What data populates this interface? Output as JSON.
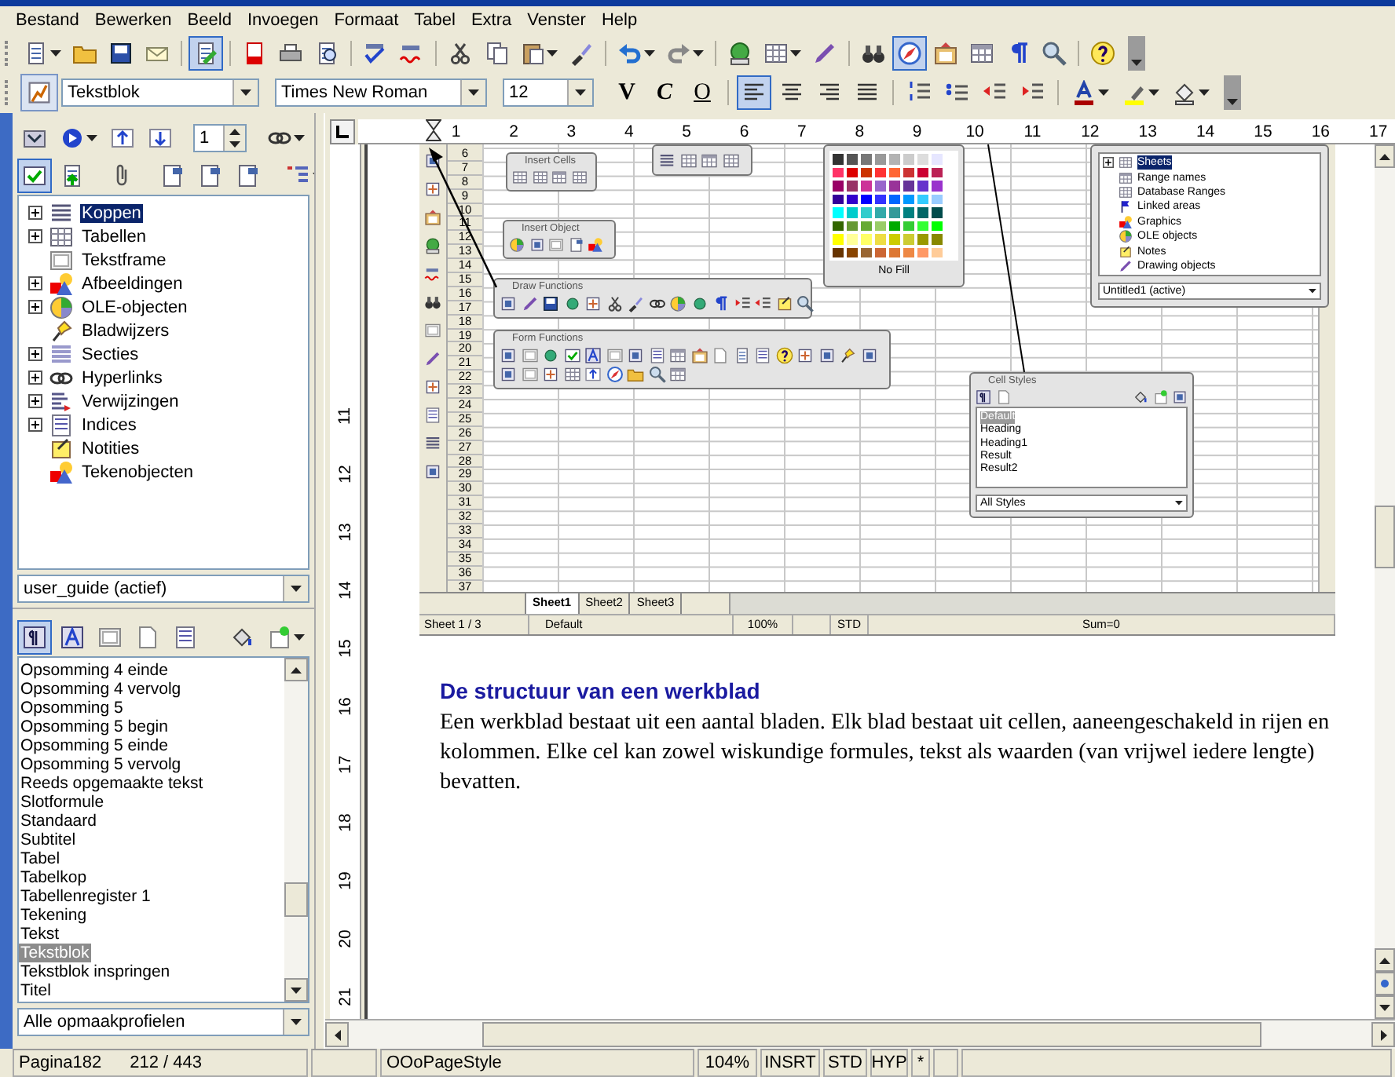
{
  "menu": [
    "Bestand",
    "Bewerken",
    "Beeld",
    "Invoegen",
    "Formaat",
    "Tabel",
    "Extra",
    "Venster",
    "Help"
  ],
  "standard_toolbar": {
    "edit_mode_on": true,
    "navigator_on": true
  },
  "format_toolbar": {
    "paragraph_style": "Tekstblok",
    "font_name": "Times New Roman",
    "font_size": "12",
    "style_buttons": [
      "V",
      "C",
      "O"
    ],
    "alignment": [
      {
        "selected": true
      },
      {
        "selected": false
      },
      {
        "selected": false
      },
      {
        "selected": false
      }
    ]
  },
  "navigator": {
    "page_number": "1",
    "content_view_on": true,
    "items": [
      {
        "label": "Koppen",
        "expandable": true,
        "selected": true
      },
      {
        "label": "Tabellen",
        "expandable": true,
        "selected": false
      },
      {
        "label": "Tekstframe",
        "expandable": false,
        "selected": false
      },
      {
        "label": "Afbeeldingen",
        "expandable": true,
        "selected": false
      },
      {
        "label": "OLE-objecten",
        "expandable": true,
        "selected": false
      },
      {
        "label": "Bladwijzers",
        "expandable": false,
        "selected": false
      },
      {
        "label": "Secties",
        "expandable": true,
        "selected": false
      },
      {
        "label": "Hyperlinks",
        "expandable": true,
        "selected": false
      },
      {
        "label": "Verwijzingen",
        "expandable": true,
        "selected": false
      },
      {
        "label": "Indices",
        "expandable": true,
        "selected": false
      },
      {
        "label": "Notities",
        "expandable": false,
        "selected": false
      },
      {
        "label": "Tekenobjecten",
        "expandable": false,
        "selected": false
      }
    ],
    "document": "user_guide (actief)"
  },
  "styles": {
    "categories": [
      {
        "selected": true
      },
      {
        "selected": false
      },
      {
        "selected": false
      },
      {
        "selected": false
      },
      {
        "selected": false
      }
    ],
    "items": [
      {
        "label": "Opsomming 4 einde",
        "selected": false
      },
      {
        "label": "Opsomming 4 vervolg",
        "selected": false
      },
      {
        "label": "Opsomming 5",
        "selected": false
      },
      {
        "label": "Opsomming 5 begin",
        "selected": false
      },
      {
        "label": "Opsomming 5 einde",
        "selected": false
      },
      {
        "label": "Opsomming 5 vervolg",
        "selected": false
      },
      {
        "label": "Reeds opgemaakte tekst",
        "selected": false
      },
      {
        "label": "Slotformule",
        "selected": false
      },
      {
        "label": "Standaard",
        "selected": false
      },
      {
        "label": "Subtitel",
        "selected": false
      },
      {
        "label": "Tabel",
        "selected": false
      },
      {
        "label": "Tabelkop",
        "selected": false
      },
      {
        "label": "Tabellenregister 1",
        "selected": false
      },
      {
        "label": "Tekening",
        "selected": false
      },
      {
        "label": "Tekst",
        "selected": false
      },
      {
        "label": "Tekstblok",
        "selected": true
      },
      {
        "label": "Tekstblok inspringen",
        "selected": false
      },
      {
        "label": "Titel",
        "selected": false
      }
    ],
    "filter": "Alle opmaakprofielen"
  },
  "ruler": {
    "horizontal": [
      "1",
      "2",
      "3",
      "4",
      "5",
      "6",
      "7",
      "8",
      "9",
      "10",
      "11",
      "12",
      "13",
      "14",
      "15",
      "16",
      "17"
    ],
    "vertical": [
      "11",
      "12",
      "13",
      "14",
      "15",
      "16",
      "17",
      "18",
      "19",
      "20",
      "21"
    ]
  },
  "spreadsheet": {
    "row_numbers": [
      "6",
      "7",
      "8",
      "9",
      "10",
      "11",
      "12",
      "13",
      "14",
      "15",
      "16",
      "17",
      "18",
      "19",
      "20",
      "21",
      "22",
      "23",
      "24",
      "25",
      "26",
      "27",
      "28",
      "29",
      "30",
      "31",
      "32",
      "33",
      "34",
      "35",
      "36",
      "37"
    ],
    "insert_cells": {
      "title": "Insert Cells"
    },
    "insert_object": {
      "title": "Insert Object"
    },
    "draw_functions": {
      "title": "Draw Functions"
    },
    "form_functions": {
      "title": "Form Functions"
    },
    "color_palette": {
      "no_fill": "No Fill",
      "swatches": [
        {
          "color": "#333333"
        },
        {
          "color": "#555555"
        },
        {
          "color": "#777777"
        },
        {
          "color": "#999999"
        },
        {
          "color": "#b3b3b3"
        },
        {
          "color": "#cccccc"
        },
        {
          "color": "#dddddd"
        },
        {
          "color": "#e6e6ff"
        },
        {
          "color": "#ff3366"
        },
        {
          "color": "#dd0000"
        },
        {
          "color": "#cc3300"
        },
        {
          "color": "#ff3333"
        },
        {
          "color": "#ff6633"
        },
        {
          "color": "#cc3333"
        },
        {
          "color": "#cc0033"
        },
        {
          "color": "#bb2255"
        },
        {
          "color": "#990066"
        },
        {
          "color": "#993366"
        },
        {
          "color": "#cc3399"
        },
        {
          "color": "#9966cc"
        },
        {
          "color": "#993399"
        },
        {
          "color": "#663399"
        },
        {
          "color": "#6633cc"
        },
        {
          "color": "#9933cc"
        },
        {
          "color": "#330099"
        },
        {
          "color": "#3300cc"
        },
        {
          "color": "#0000ff"
        },
        {
          "color": "#3333ff"
        },
        {
          "color": "#0066ff"
        },
        {
          "color": "#0099ff"
        },
        {
          "color": "#33ccff"
        },
        {
          "color": "#99ccff"
        },
        {
          "color": "#00ffff"
        },
        {
          "color": "#00cccc"
        },
        {
          "color": "#33cccc"
        },
        {
          "color": "#33aaaa"
        },
        {
          "color": "#339999"
        },
        {
          "color": "#008080"
        },
        {
          "color": "#006666"
        },
        {
          "color": "#004c4c"
        },
        {
          "color": "#336600"
        },
        {
          "color": "#669933"
        },
        {
          "color": "#66aa33"
        },
        {
          "color": "#99cc66"
        },
        {
          "color": "#00aa00"
        },
        {
          "color": "#33cc33"
        },
        {
          "color": "#33ff33"
        },
        {
          "color": "#00ff00"
        },
        {
          "color": "#ffff00"
        },
        {
          "color": "#ffff99"
        },
        {
          "color": "#ffff66"
        },
        {
          "color": "#eedd44"
        },
        {
          "color": "#cccc00"
        },
        {
          "color": "#cccc33"
        },
        {
          "color": "#999900"
        },
        {
          "color": "#888800"
        },
        {
          "color": "#663300"
        },
        {
          "color": "#884400"
        },
        {
          "color": "#996633"
        },
        {
          "color": "#cc6633"
        },
        {
          "color": "#dd7733"
        },
        {
          "color": "#ee8844"
        },
        {
          "color": "#ff9966"
        },
        {
          "color": "#ffcc99"
        }
      ]
    },
    "navigator": {
      "items": [
        {
          "label": "Sheets",
          "expandable": true,
          "selected": true
        },
        {
          "label": "Range names",
          "expandable": false,
          "selected": false
        },
        {
          "label": "Database Ranges",
          "expandable": false,
          "selected": false
        },
        {
          "label": "Linked areas",
          "expandable": false,
          "selected": false
        },
        {
          "label": "Graphics",
          "expandable": false,
          "selected": false
        },
        {
          "label": "OLE objects",
          "expandable": false,
          "selected": false
        },
        {
          "label": "Notes",
          "expandable": false,
          "selected": false
        },
        {
          "label": "Drawing objects",
          "expandable": false,
          "selected": false
        }
      ],
      "document": "Untitled1 (active)"
    },
    "cell_styles": {
      "title": "Cell Styles",
      "items": [
        {
          "label": "Default",
          "selected": true
        },
        {
          "label": "Heading",
          "selected": false
        },
        {
          "label": "Heading1",
          "selected": false
        },
        {
          "label": "Result",
          "selected": false
        },
        {
          "label": "Result2",
          "selected": false
        }
      ],
      "filter": "All Styles"
    },
    "sheet_tabs": [
      {
        "label": "Sheet1",
        "selected": true
      },
      {
        "label": "Sheet2",
        "selected": false
      },
      {
        "label": "Sheet3",
        "selected": false
      }
    ],
    "status_bar": {
      "sheet": "Sheet 1 / 3",
      "page_style": "Default",
      "zoom": "100%",
      "selection_mode": "STD",
      "sum": "Sum=0"
    }
  },
  "document": {
    "heading": "De structuur van een werkblad",
    "paragraph": "Een werkblad bestaat uit een aantal bladen. Elk blad bestaat uit cellen, aaneengeschakeld in rijen en kolommen. Elke cel kan zowel wiskundige formules, tekst als waarden (van vrijwel iedere lengte) bevatten."
  },
  "status_bar": {
    "page": "Pagina182",
    "pages": "212 / 443",
    "page_style": "OOoPageStyle",
    "zoom": "104%",
    "insert_mode": "INSRT",
    "selection_mode": "STD",
    "hyperlink_mode": "HYP",
    "modified": "*"
  }
}
